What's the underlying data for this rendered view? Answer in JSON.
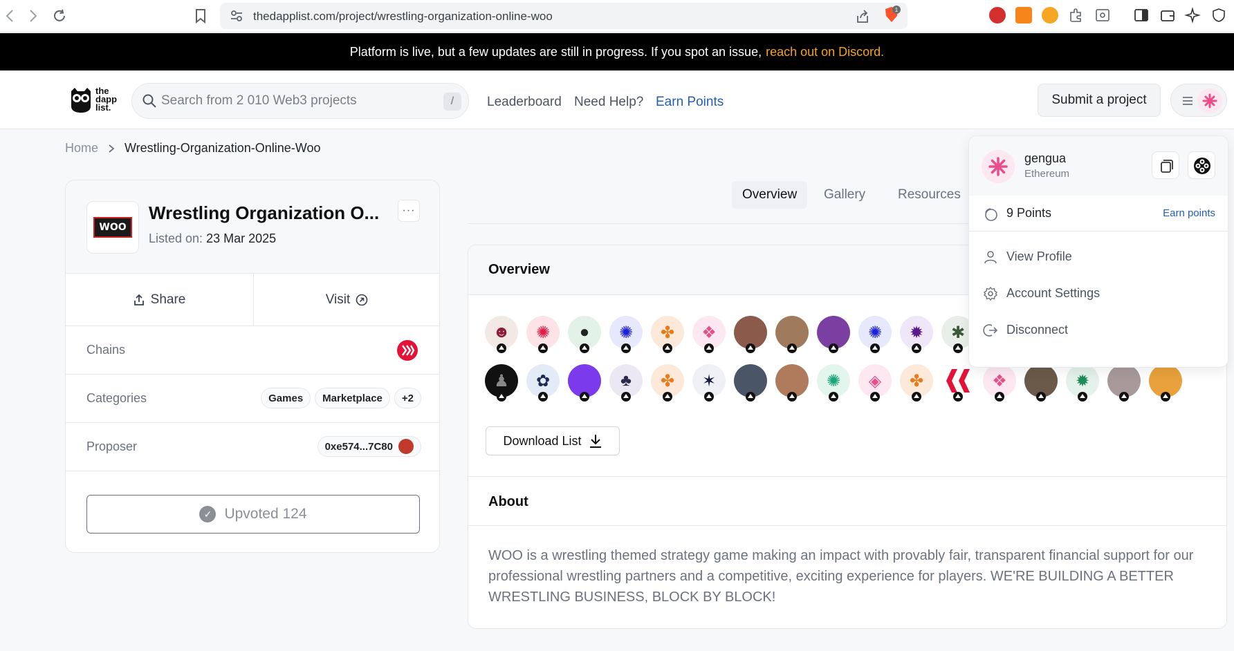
{
  "browser": {
    "url": "thedapplist.com/project/wrestling-organization-online-woo",
    "brave_badge": "1"
  },
  "announcement": {
    "text": "Platform is live, but a few updates are still in progress. If you spot an issue,",
    "link": "reach out on Discord."
  },
  "header": {
    "logo_text": "the dapp list.",
    "search_placeholder": "Search from 2 010 Web3 projects",
    "search_shortcut": "/",
    "nav": [
      "Leaderboard",
      "Need Help?",
      "Earn Points"
    ],
    "submit_label": "Submit a project"
  },
  "breadcrumb": {
    "home": "Home",
    "current": "Wrestling-Organization-Online-Woo"
  },
  "project": {
    "logo_text": "WOO",
    "title": "Wrestling Organization O...",
    "listed_label": "Listed on:",
    "listed_date": "23 Mar 2025",
    "more": "···",
    "share": "Share",
    "visit": "Visit",
    "chains_label": "Chains",
    "categories_label": "Categories",
    "categories": [
      "Games",
      "Marketplace",
      "+2"
    ],
    "proposer_label": "Proposer",
    "proposer": "0xe574...7C80",
    "upvoted": "Upvoted 124"
  },
  "tabs": [
    "Overview",
    "Gallery",
    "Resources"
  ],
  "overview": {
    "title": "Overview",
    "download": "Download List",
    "about_title": "About",
    "about_text": "WOO is a wrestling themed strategy game making an impact with provably fair, transparent financial support for our professional wrestling partners and a competitive, exciting experience for players. WE'RE BUILDING A BETTER WRESTLING BUSINESS, BLOCK BY BLOCK!"
  },
  "dropdown": {
    "username": "gengua",
    "chain": "Ethereum",
    "points": "9 Points",
    "earn_points": "Earn points",
    "items": [
      "View Profile",
      "Account Settings",
      "Disconnect"
    ]
  },
  "colors": {
    "accent_blue": "#1f5fb8",
    "announce_link": "#f7a21b",
    "hive_red": "#e31337"
  }
}
